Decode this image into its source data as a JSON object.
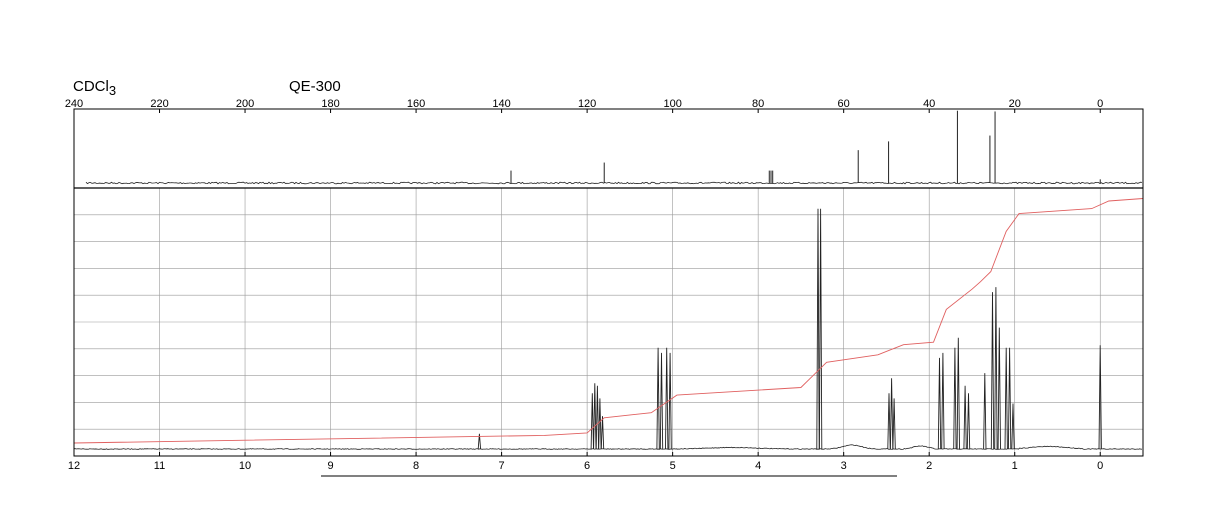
{
  "header": {
    "solvent_base": "CDCl",
    "solvent_sub": "3",
    "instrument": "QE-300"
  },
  "chart_data": [
    {
      "type": "line",
      "nucleus": "13C",
      "x_axis": {
        "range": [
          240,
          -10
        ],
        "ticks": [
          240,
          220,
          200,
          180,
          160,
          140,
          120,
          100,
          80,
          60,
          40,
          20,
          0
        ],
        "tick_labels": [
          "240",
          "220",
          "200",
          "180",
          "160",
          "140",
          "120",
          "100",
          "80",
          "60",
          "40",
          "20",
          "0"
        ]
      },
      "peaks": [
        {
          "x": 137.8,
          "height": 0.17
        },
        {
          "x": 116.0,
          "height": 0.28
        },
        {
          "x": 77.4,
          "height": 0.17
        },
        {
          "x": 77.0,
          "height": 0.17
        },
        {
          "x": 76.6,
          "height": 0.17
        },
        {
          "x": 56.6,
          "height": 0.45
        },
        {
          "x": 49.5,
          "height": 0.57
        },
        {
          "x": 33.4,
          "height": 0.99
        },
        {
          "x": 25.8,
          "height": 0.65
        },
        {
          "x": 24.6,
          "height": 0.98
        },
        {
          "x": 0.0,
          "height": 0.05
        }
      ]
    },
    {
      "type": "line",
      "nucleus": "1H",
      "x_axis": {
        "range": [
          12,
          -0.5
        ],
        "ticks": [
          12,
          11,
          10,
          9,
          8,
          7,
          6,
          5,
          4,
          3,
          2,
          1,
          0
        ],
        "tick_labels": [
          "12",
          "11",
          "10",
          "9",
          "8",
          "7",
          "6",
          "5",
          "4",
          "3",
          "2",
          "1",
          "0"
        ]
      },
      "grid": true,
      "peaks": [
        {
          "x": 7.26,
          "height": 0.06
        },
        {
          "x": 5.94,
          "height": 0.22
        },
        {
          "x": 5.91,
          "height": 0.26
        },
        {
          "x": 5.88,
          "height": 0.25
        },
        {
          "x": 5.85,
          "height": 0.2
        },
        {
          "x": 5.82,
          "height": 0.13
        },
        {
          "x": 5.17,
          "height": 0.4
        },
        {
          "x": 5.13,
          "height": 0.38
        },
        {
          "x": 5.07,
          "height": 0.4
        },
        {
          "x": 5.03,
          "height": 0.38
        },
        {
          "x": 3.3,
          "height": 0.95
        },
        {
          "x": 3.27,
          "height": 0.95
        },
        {
          "x": 2.47,
          "height": 0.22
        },
        {
          "x": 2.44,
          "height": 0.28
        },
        {
          "x": 2.41,
          "height": 0.2
        },
        {
          "x": 1.88,
          "height": 0.36
        },
        {
          "x": 1.84,
          "height": 0.38
        },
        {
          "x": 1.7,
          "height": 0.4
        },
        {
          "x": 1.66,
          "height": 0.44
        },
        {
          "x": 1.58,
          "height": 0.25
        },
        {
          "x": 1.54,
          "height": 0.22
        },
        {
          "x": 1.35,
          "height": 0.3
        },
        {
          "x": 1.26,
          "height": 0.62
        },
        {
          "x": 1.22,
          "height": 0.64
        },
        {
          "x": 1.18,
          "height": 0.48
        },
        {
          "x": 1.1,
          "height": 0.4
        },
        {
          "x": 1.06,
          "height": 0.4
        },
        {
          "x": 1.02,
          "height": 0.18
        },
        {
          "x": 0.0,
          "height": 0.41
        }
      ],
      "integral": [
        {
          "x": 12.0,
          "y": 0.02
        },
        {
          "x": 6.5,
          "y": 0.05
        },
        {
          "x": 6.0,
          "y": 0.06
        },
        {
          "x": 5.8,
          "y": 0.12
        },
        {
          "x": 5.25,
          "y": 0.14
        },
        {
          "x": 4.95,
          "y": 0.21
        },
        {
          "x": 3.5,
          "y": 0.24
        },
        {
          "x": 3.2,
          "y": 0.34
        },
        {
          "x": 2.6,
          "y": 0.37
        },
        {
          "x": 2.3,
          "y": 0.41
        },
        {
          "x": 1.95,
          "y": 0.42
        },
        {
          "x": 1.8,
          "y": 0.55
        },
        {
          "x": 1.5,
          "y": 0.63
        },
        {
          "x": 1.4,
          "y": 0.66
        },
        {
          "x": 1.28,
          "y": 0.7
        },
        {
          "x": 1.1,
          "y": 0.86
        },
        {
          "x": 0.95,
          "y": 0.93
        },
        {
          "x": 0.1,
          "y": 0.95
        },
        {
          "x": -0.1,
          "y": 0.98
        },
        {
          "x": -0.5,
          "y": 0.99
        }
      ]
    }
  ],
  "colors": {
    "spectrum": "#222222",
    "integral": "#e06060",
    "grid": "#9a9a9a",
    "frame": "#000000"
  }
}
